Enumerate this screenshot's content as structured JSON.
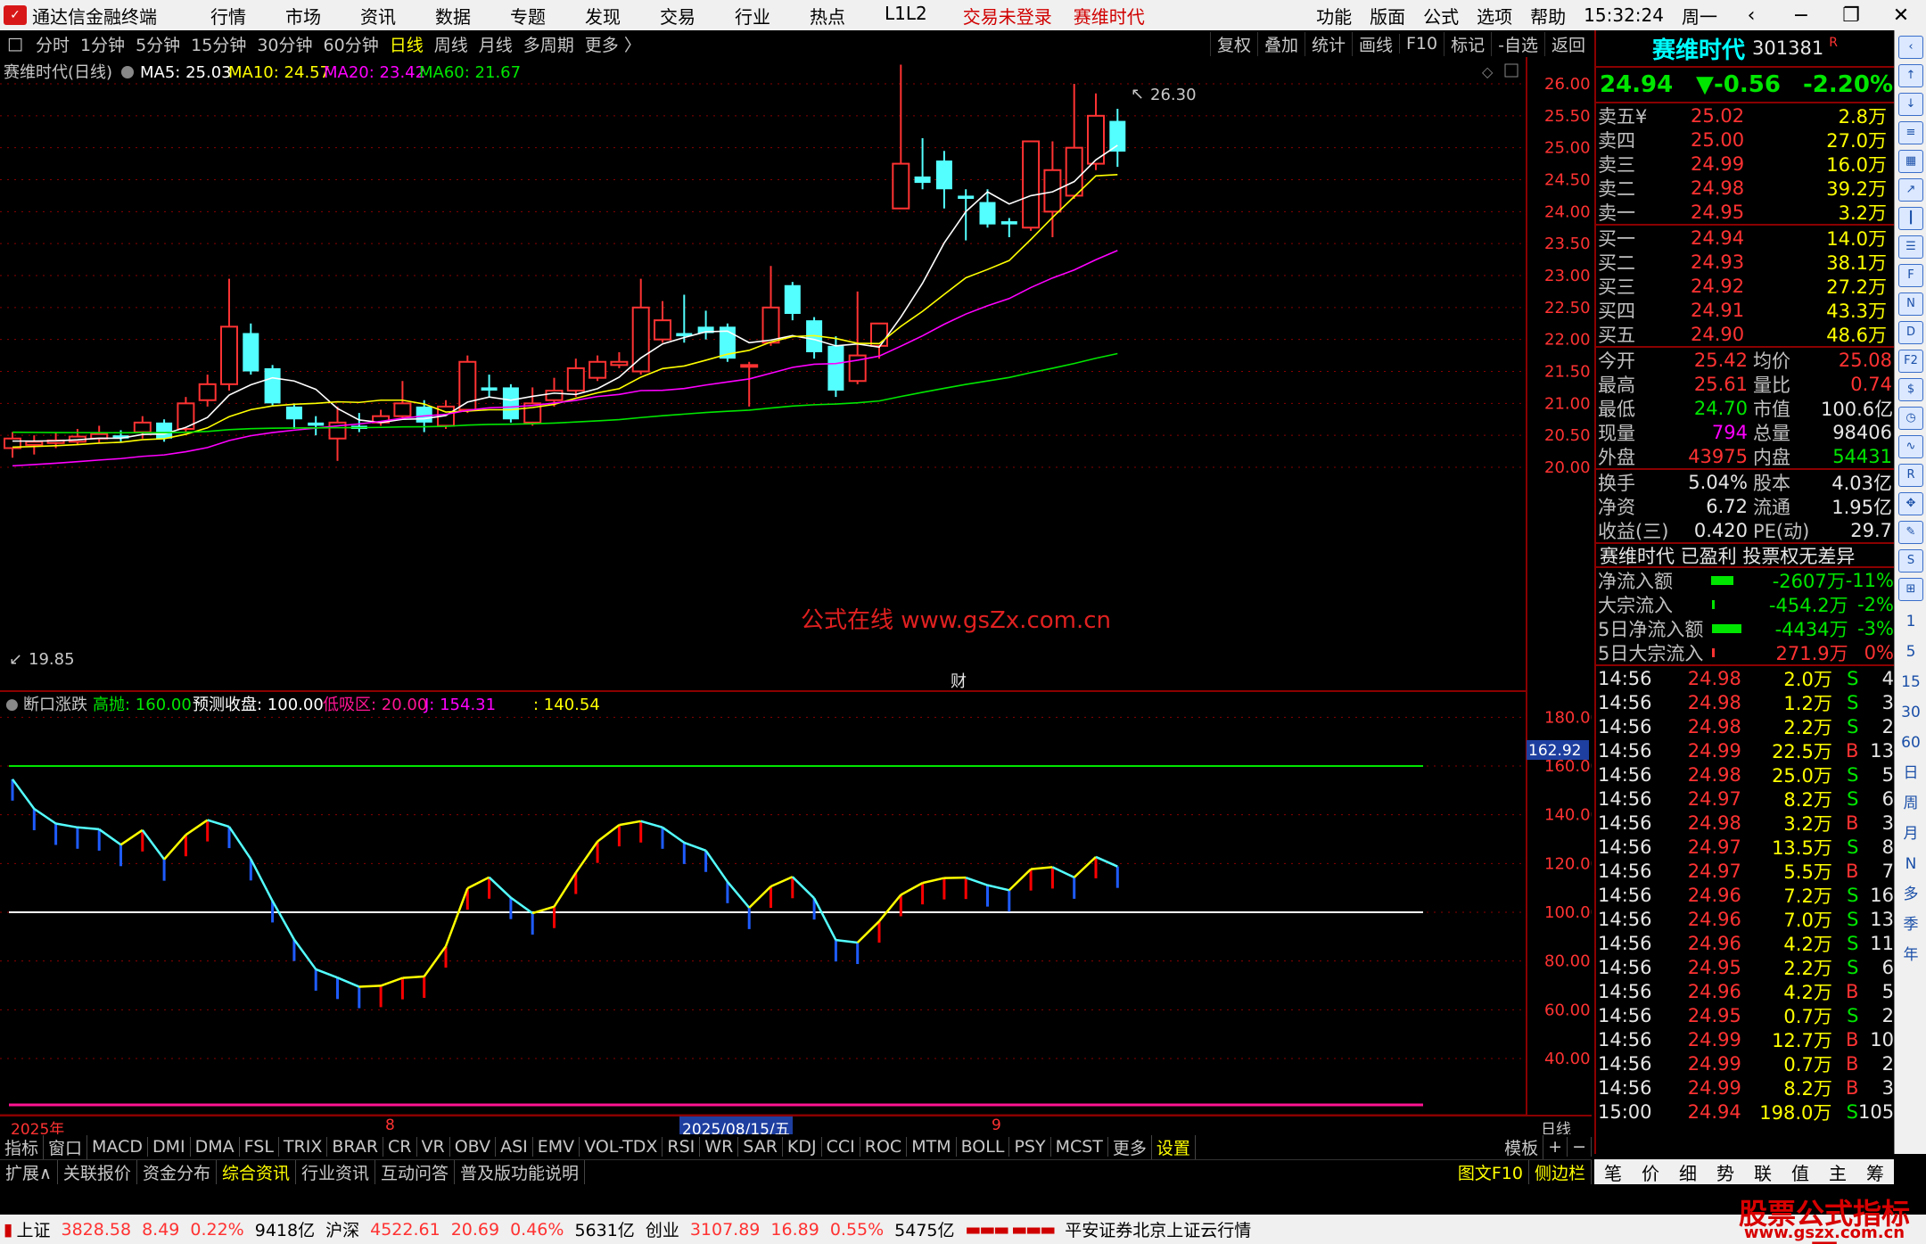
{
  "menu": {
    "app_title": "通达信金融终端",
    "items": [
      "行情",
      "市场",
      "资讯",
      "数据",
      "专题",
      "发现",
      "交易",
      "行业",
      "热点",
      "L1L2"
    ],
    "warn1": "交易未登录",
    "warn2": "赛维时代",
    "right_items": [
      "功能",
      "版面",
      "公式",
      "选项",
      "帮助"
    ],
    "clock": "15:32:24",
    "weekday": "周一"
  },
  "period": {
    "items": [
      "分时",
      "1分钟",
      "5分钟",
      "15分钟",
      "30分钟",
      "60分钟",
      "日线",
      "周线",
      "月线",
      "多周期",
      "更多 〉"
    ],
    "active": "日线",
    "right_buttons": [
      "复权",
      "叠加",
      "统计",
      "画线",
      "F10",
      "标记",
      "-自选",
      "返回"
    ]
  },
  "main_chart": {
    "title": "赛维时代(日线)",
    "ma5": "MA5: 25.03",
    "ma10": "MA10: 24.57",
    "ma20": "MA20: 23.42",
    "ma60": "MA60: 21.67",
    "high_label": "26.30",
    "low_label": "19.85",
    "watermark": "公式在线  www.gsZx.com.cn",
    "marker": "财",
    "price_ticks": [
      "26.00",
      "25.50",
      "25.00",
      "24.50",
      "24.00",
      "23.50",
      "23.00",
      "22.50",
      "22.00",
      "21.50",
      "21.00",
      "20.50",
      "20.00"
    ]
  },
  "indicator": {
    "name": "断口涨跌",
    "high_sell": "高抛: 160.00",
    "forecast": "预测收盘: 100.00",
    "low_buy": "低吸区: 20.00",
    "j": "J: 154.31",
    "extra": ": 140.54",
    "current": "162.92",
    "ticks": [
      "180.00",
      "160.00",
      "140.00",
      "120.00",
      "100.00",
      "80.00",
      "60.00",
      "40.00"
    ],
    "date_year": "2025年",
    "date_mark1": "8",
    "date_cursor": "2025/08/15/五",
    "date_mark2": "9",
    "period_label": "日线"
  },
  "chart_data": {
    "type": "candlestick",
    "candles": [
      [
        20.3,
        20.45,
        20.55,
        20.15
      ],
      [
        20.35,
        20.4,
        20.5,
        20.2
      ],
      [
        20.38,
        20.42,
        20.55,
        20.3
      ],
      [
        20.4,
        20.48,
        20.6,
        20.35
      ],
      [
        20.45,
        20.52,
        20.65,
        20.38
      ],
      [
        20.5,
        20.45,
        20.58,
        20.4
      ],
      [
        20.55,
        20.7,
        20.8,
        20.45
      ],
      [
        20.7,
        20.45,
        20.75,
        20.4
      ],
      [
        20.6,
        21.0,
        21.1,
        20.55
      ],
      [
        21.05,
        21.3,
        21.45,
        20.95
      ],
      [
        21.3,
        22.2,
        22.95,
        21.2
      ],
      [
        22.1,
        21.5,
        22.25,
        21.45
      ],
      [
        21.55,
        21.0,
        21.6,
        20.95
      ],
      [
        20.95,
        20.75,
        21.0,
        20.6
      ],
      [
        20.7,
        20.65,
        20.8,
        20.5
      ],
      [
        20.45,
        20.7,
        20.95,
        20.1
      ],
      [
        20.65,
        20.6,
        20.85,
        20.55
      ],
      [
        20.7,
        20.8,
        20.9,
        20.65
      ],
      [
        20.8,
        21.0,
        21.35,
        20.75
      ],
      [
        20.95,
        20.7,
        21.05,
        20.55
      ],
      [
        20.65,
        20.95,
        21.05,
        20.6
      ],
      [
        20.9,
        21.65,
        21.75,
        20.85
      ],
      [
        21.25,
        21.2,
        21.45,
        21.1
      ],
      [
        21.25,
        20.75,
        21.3,
        20.7
      ],
      [
        20.7,
        21.0,
        21.25,
        20.65
      ],
      [
        21.05,
        21.2,
        21.4,
        20.95
      ],
      [
        21.2,
        21.55,
        21.7,
        21.1
      ],
      [
        21.4,
        21.65,
        21.75,
        21.35
      ],
      [
        21.6,
        21.65,
        21.8,
        21.55
      ],
      [
        21.5,
        22.5,
        22.95,
        21.45
      ],
      [
        22.0,
        22.3,
        22.6,
        21.95
      ],
      [
        22.1,
        22.05,
        22.7,
        21.95
      ],
      [
        22.2,
        22.1,
        22.45,
        22.0
      ],
      [
        22.2,
        21.7,
        22.25,
        21.65
      ],
      [
        21.6,
        21.6,
        21.65,
        20.95
      ],
      [
        21.95,
        22.5,
        23.15,
        21.9
      ],
      [
        22.85,
        22.4,
        22.9,
        22.3
      ],
      [
        22.3,
        21.8,
        22.35,
        21.7
      ],
      [
        21.9,
        21.2,
        22.05,
        21.1
      ],
      [
        21.35,
        21.75,
        22.75,
        21.3
      ],
      [
        21.9,
        22.25,
        22.25,
        21.7
      ],
      [
        24.05,
        24.75,
        26.3,
        24.05
      ],
      [
        24.55,
        24.45,
        25.15,
        24.35
      ],
      [
        24.8,
        24.35,
        24.95,
        24.05
      ],
      [
        24.25,
        24.2,
        24.35,
        23.55
      ],
      [
        24.15,
        23.8,
        24.35,
        23.75
      ],
      [
        23.85,
        23.8,
        23.9,
        23.6
      ],
      [
        23.75,
        25.1,
        25.1,
        23.7
      ],
      [
        24.0,
        24.65,
        25.1,
        23.6
      ],
      [
        24.25,
        25.0,
        26.0,
        24.2
      ],
      [
        24.75,
        25.5,
        25.85,
        24.65
      ],
      [
        25.42,
        24.94,
        25.61,
        24.7
      ]
    ]
  },
  "quote": {
    "name": "赛维时代",
    "code": "301381",
    "badge": "R",
    "price": "24.94",
    "change": "▼-0.56",
    "pct": "-2.20%",
    "asks": [
      {
        "label": "卖五",
        "sym": "¥",
        "price": "25.02",
        "vol": "2.8万"
      },
      {
        "label": "卖四",
        "sym": "",
        "price": "25.00",
        "vol": "27.0万"
      },
      {
        "label": "卖三",
        "sym": "",
        "price": "24.99",
        "vol": "16.0万"
      },
      {
        "label": "卖二",
        "sym": "",
        "price": "24.98",
        "vol": "39.2万"
      },
      {
        "label": "卖一",
        "sym": "",
        "price": "24.95",
        "vol": "3.2万"
      }
    ],
    "bids": [
      {
        "label": "买一",
        "price": "24.94",
        "vol": "14.0万"
      },
      {
        "label": "买二",
        "price": "24.93",
        "vol": "38.1万"
      },
      {
        "label": "买三",
        "price": "24.92",
        "vol": "27.2万"
      },
      {
        "label": "买四",
        "price": "24.91",
        "vol": "43.3万"
      },
      {
        "label": "买五",
        "price": "24.90",
        "vol": "48.6万"
      }
    ],
    "stats": [
      [
        "今开",
        "25.42",
        "red",
        "均价",
        "25.08",
        "red"
      ],
      [
        "最高",
        "25.61",
        "red",
        "量比",
        "0.74",
        "red"
      ],
      [
        "最低",
        "24.70",
        "green",
        "市值",
        "100.6亿",
        "white"
      ],
      [
        "现量",
        "794",
        "mag",
        "总量",
        "98406",
        "white"
      ],
      [
        "外盘",
        "43975",
        "red",
        "内盘",
        "54431",
        "green"
      ]
    ],
    "stats2": [
      [
        "换手",
        "5.04%",
        "white",
        "股本",
        "4.03亿",
        "white"
      ],
      [
        "净资",
        "6.72",
        "white",
        "流通",
        "1.95亿",
        "white"
      ],
      [
        "收益(三)",
        "0.420",
        "white",
        "PE(动)",
        "29.7",
        "white"
      ]
    ],
    "info_line": "赛维时代 已盈利 投票权无差异",
    "flows": [
      {
        "label": "净流入额",
        "value": "-2607万",
        "pct": "-11%",
        "vc": "green",
        "bar": 0.45
      },
      {
        "label": "大宗流入",
        "value": "-454.2万",
        "pct": "-2%",
        "vc": "green",
        "bar": 0.02
      },
      {
        "label": "5日净流入额",
        "value": "-4434万",
        "pct": "-3%",
        "vc": "green",
        "bar": 0.6
      },
      {
        "label": "5日大宗流入",
        "value": "271.9万",
        "pct": "0%",
        "vc": "red",
        "bar": 0.02
      }
    ],
    "ticks": [
      [
        "14:56",
        "24.98",
        "2.0万",
        "S",
        "4"
      ],
      [
        "14:56",
        "24.98",
        "1.2万",
        "S",
        "3"
      ],
      [
        "14:56",
        "24.98",
        "2.2万",
        "S",
        "2"
      ],
      [
        "14:56",
        "24.99",
        "22.5万",
        "B",
        "13"
      ],
      [
        "14:56",
        "24.98",
        "25.0万",
        "S",
        "5"
      ],
      [
        "14:56",
        "24.97",
        "8.2万",
        "S",
        "6"
      ],
      [
        "14:56",
        "24.98",
        "3.2万",
        "B",
        "3"
      ],
      [
        "14:56",
        "24.97",
        "13.5万",
        "S",
        "8"
      ],
      [
        "14:56",
        "24.97",
        "5.5万",
        "B",
        "7"
      ],
      [
        "14:56",
        "24.96",
        "7.2万",
        "S",
        "16"
      ],
      [
        "14:56",
        "24.96",
        "7.0万",
        "S",
        "13"
      ],
      [
        "14:56",
        "24.96",
        "4.2万",
        "S",
        "11"
      ],
      [
        "14:56",
        "24.95",
        "2.2万",
        "S",
        "6"
      ],
      [
        "14:56",
        "24.96",
        "4.2万",
        "B",
        "5"
      ],
      [
        "14:56",
        "24.95",
        "0.7万",
        "S",
        "2"
      ],
      [
        "14:56",
        "24.99",
        "12.7万",
        "B",
        "10"
      ],
      [
        "14:56",
        "24.99",
        "0.7万",
        "B",
        "2"
      ],
      [
        "14:56",
        "24.99",
        "8.2万",
        "B",
        "3"
      ],
      [
        "15:00",
        "24.94",
        "198.0万",
        "S",
        "105"
      ]
    ]
  },
  "ind_tabs": [
    "指标",
    "窗口",
    "MACD",
    "DMI",
    "DMA",
    "FSL",
    "TRIX",
    "BRAR",
    "CR",
    "VR",
    "OBV",
    "ASI",
    "EMV",
    "VOL-TDX",
    "RSI",
    "WR",
    "SAR",
    "KDJ",
    "CCI",
    "ROC",
    "MTM",
    "BOLL",
    "PSY",
    "MCST",
    "更多",
    "设置"
  ],
  "ind_tab_active": "设置",
  "ind_tabs_right": [
    "模板",
    "+",
    "−"
  ],
  "ext_tabs": [
    "扩展∧",
    "关联报价",
    "资金分布",
    "综合资讯",
    "行业资讯",
    "互动问答",
    "普及版功能说明"
  ],
  "ext_right": [
    "图文F10",
    "侧边栏"
  ],
  "rbot_tabs": [
    "笔",
    "价",
    "细",
    "势",
    "联",
    "值",
    "主",
    "筹"
  ],
  "side_chars": [
    "日",
    "周",
    "月",
    "N",
    "多",
    "季",
    "年"
  ],
  "side_nums": [
    "1",
    "5",
    "15",
    "30",
    "60"
  ],
  "status": {
    "sh": "上证",
    "sh_val": "3828.58",
    "sh_chg": "8.49",
    "sh_pct": "0.22%",
    "sh_amt": "9418亿",
    "sz": "沪深",
    "sz_val": "4522.61",
    "sz_chg": "20.69",
    "sz_pct": "0.46%",
    "sz_amt": "5631亿",
    "cy": "创业",
    "cy_val": "3107.89",
    "cy_chg": "16.89",
    "cy_pct": "0.55%",
    "cy_amt": "5475亿",
    "broker": "平安证券北京上证云行情"
  },
  "brand": {
    "name": "股票公式指标网",
    "url": "www.gszx.com.cn"
  },
  "colors": {
    "up": "#ff3232",
    "down": "#54ffff",
    "ma5": "#ffffff",
    "ma10": "#ffff00",
    "ma20": "#ff00ff",
    "ma60": "#00e600"
  }
}
